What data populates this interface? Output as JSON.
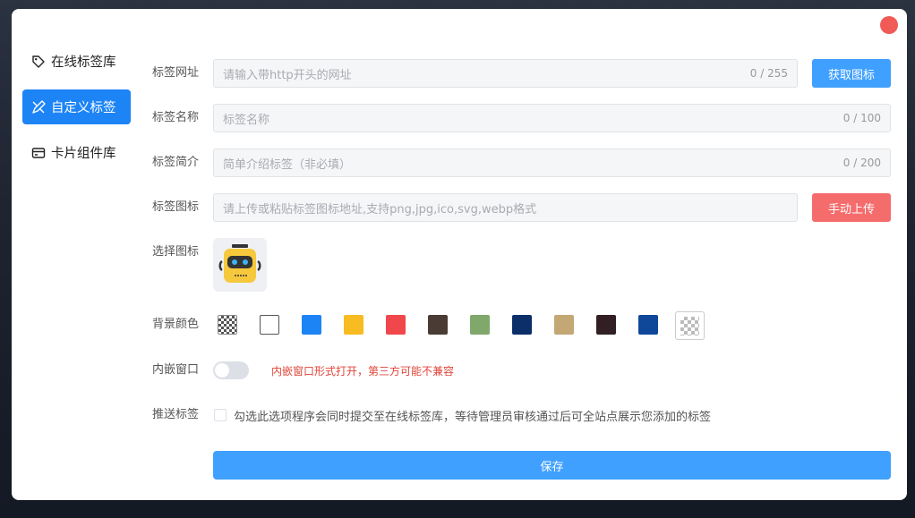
{
  "sidebar": {
    "items": [
      {
        "label": "在线标签库",
        "icon": "tag-icon",
        "active": false
      },
      {
        "label": "自定义标签",
        "icon": "pen-ruler-icon",
        "active": true
      },
      {
        "label": "卡片组件库",
        "icon": "card-icon",
        "active": false
      }
    ]
  },
  "form": {
    "url": {
      "label": "标签网址",
      "placeholder": "请输入带http开头的网址",
      "count": "0 / 255",
      "button": "获取图标"
    },
    "name": {
      "label": "标签名称",
      "placeholder": "标签名称",
      "count": "0 / 100"
    },
    "desc": {
      "label": "标签简介",
      "placeholder": "简单介绍标签（非必填）",
      "count": "0 / 200"
    },
    "icon": {
      "label": "标签图标",
      "placeholder": "请上传或粘贴标签图标地址,支持png,jpg,ico,svg,webp格式",
      "button": "手动上传"
    },
    "choose_icon": {
      "label": "选择图标"
    },
    "bg_color": {
      "label": "背景颜色",
      "swatches": [
        "transparent",
        "#ffffff",
        "#1d84f6",
        "#f8bb22",
        "#f0474c",
        "#4a3c35",
        "#81a86b",
        "#0c2f69",
        "#c3a774",
        "#321f23",
        "#0f4899"
      ],
      "selected": "transparent"
    },
    "embed": {
      "label": "内嵌窗口",
      "hint": "内嵌窗口形式打开，第三方可能不兼容",
      "enabled": false
    },
    "push": {
      "label": "推送标签",
      "text": "勾选此选项程序会同时提交至在线标签库，等待管理员审核通过后可全站点展示您添加的标签",
      "checked": false
    },
    "save": "保存"
  },
  "colors": {
    "accent": "#40a0ff",
    "danger": "#f56c6c",
    "close": "#f05b57",
    "active": "#1d84f6"
  }
}
